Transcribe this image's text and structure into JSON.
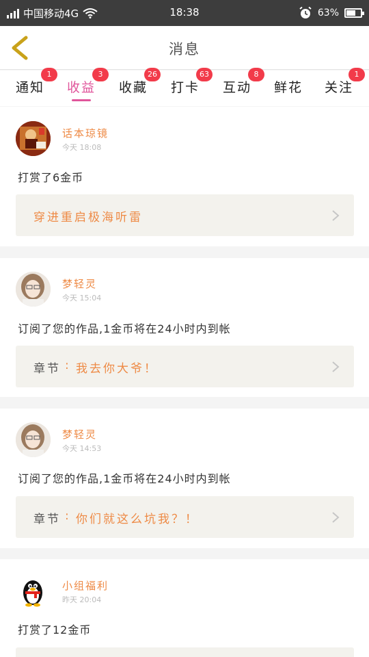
{
  "status_bar": {
    "carrier": "中国移动4G",
    "time": "18:38",
    "battery": "63%",
    "battery_level": 0.63,
    "icons": [
      "signal-icon",
      "wifi-icon",
      "alarm-icon",
      "battery-icon"
    ]
  },
  "header": {
    "title": "消息",
    "back_icon": "chevron-left-icon",
    "back_color": "#c9a21a"
  },
  "tabs": [
    {
      "label": "通知",
      "badge": "1"
    },
    {
      "label": "收益",
      "badge": "3",
      "active": true
    },
    {
      "label": "收藏",
      "badge": "26"
    },
    {
      "label": "打卡",
      "badge": "63"
    },
    {
      "label": "互动",
      "badge": "8"
    },
    {
      "label": "鲜花",
      "badge": ""
    },
    {
      "label": "关注",
      "badge": "1"
    }
  ],
  "colors": {
    "accent_pink": "#e0559b",
    "badge_red": "#f23b4a",
    "name_orange": "#ee8a45",
    "link_bg": "#f3f2ed"
  },
  "messages": [
    {
      "user": "话本琼镜",
      "time": "今天 18:08",
      "content": "打赏了6金币",
      "link": {
        "title": "穿进重启极海听雷"
      },
      "avatar": "book-cover-avatar"
    },
    {
      "user": "梦轻灵",
      "time": "今天 15:04",
      "content": "订阅了您的作品,1金币将在24小时内到帐",
      "link": {
        "label": "章节",
        "sep": ":",
        "chapter": "我去你大爷！"
      },
      "avatar": "girl-photo-avatar"
    },
    {
      "user": "梦轻灵",
      "time": "今天 14:53",
      "content": "订阅了您的作品,1金币将在24小时内到帐",
      "link": {
        "label": "章节",
        "sep": ":",
        "chapter": "你们就这么坑我？！"
      },
      "avatar": "girl-photo-avatar"
    },
    {
      "user": "小组福利",
      "time": "昨天 20:04",
      "content": "打赏了12金币",
      "avatar": "qq-penguin-avatar"
    }
  ]
}
